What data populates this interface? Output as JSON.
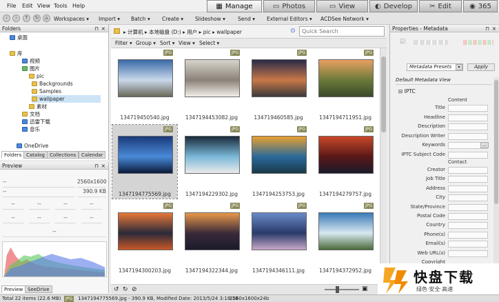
{
  "menu": {
    "file": "File",
    "edit": "Edit",
    "view": "View",
    "tools": "Tools",
    "help": "Help"
  },
  "modes": {
    "manage": "Manage",
    "photos": "Photos",
    "view": "View",
    "develop": "Develop",
    "edit": "Edit",
    "m365": "365"
  },
  "toolbar": {
    "workspaces": "Workspaces ▾",
    "import": "Import ▾",
    "batch": "Batch ▾",
    "create": "Create ▾",
    "slideshow": "Slideshow ▾",
    "send": "Send ▾",
    "external_editors": "External Editors ▾",
    "acdsee_network": "ACDSee Network ▾"
  },
  "folders": {
    "title": "Folders",
    "items": [
      "桌面",
      "库",
      "视频",
      "图片",
      "pic",
      "Backgrounds",
      "Samples",
      "wallpaper",
      "素材",
      "文档",
      "迅雷下载",
      "音乐",
      "OneDrive"
    ]
  },
  "left_tabs": [
    "Folders",
    "Catalog",
    "Collections",
    "Calendar"
  ],
  "preview": {
    "title": "Preview",
    "dims": "2560x1600",
    "dash": "--",
    "zoom": "390.9 KB"
  },
  "preview_tabs": [
    "Preview",
    "SeeDrive"
  ],
  "address": {
    "path": "▸ 计算机 ▸ 本地磁盘 (D:) ▸ 用户 ▸ pic ▸ wallpaper",
    "search_placeholder": "Quick Search"
  },
  "filterbar": {
    "filter": "Filter ▾",
    "group": "Group ▾",
    "sort": "Sort ▾",
    "view": "View ▾",
    "select": "Select ▾"
  },
  "files": [
    {
      "name": "134719450540.jpg",
      "badge": "JPG",
      "colors": [
        "#3a6aa8",
        "#c9d8ea",
        "#6a6a5a"
      ]
    },
    {
      "name": "1347194453082.jpg",
      "badge": "JPG",
      "colors": [
        "#d8d4cc",
        "#8a8278",
        "#f2efe8"
      ]
    },
    {
      "name": "134719460585.jpg",
      "badge": "JPG",
      "colors": [
        "#2a2a48",
        "#c87848",
        "#3a3a3a"
      ]
    },
    {
      "name": "1347194711951.jpg",
      "badge": "JPG",
      "colors": [
        "#e8a060",
        "#6a7a3a",
        "#3a4a28"
      ]
    },
    {
      "name": "1347194775569.jpg",
      "badge": "JPG",
      "colors": [
        "#1a3a7a",
        "#4a8ad8",
        "#0a1a3a"
      ]
    },
    {
      "name": "1347194229302.jpg",
      "badge": "JPG",
      "colors": [
        "#1a2a3a",
        "#7ab8d8",
        "#eaeaea"
      ]
    },
    {
      "name": "1347194253753.jpg",
      "badge": "JPG",
      "colors": [
        "#e8a030",
        "#2a6a9a",
        "#1a3a4a"
      ]
    },
    {
      "name": "1347194279757.jpg",
      "badge": "JPG",
      "colors": [
        "#c84828",
        "#5a1818",
        "#1a1a2a"
      ]
    },
    {
      "name": "1347194300203.jpg",
      "badge": "JPG",
      "colors": [
        "#e87838",
        "#2a2a3a",
        "#c85828"
      ]
    },
    {
      "name": "1347194322344.jpg",
      "badge": "JPG",
      "colors": [
        "#e89848",
        "#3a2a3a",
        "#1a1a2a"
      ]
    },
    {
      "name": "1347194346111.jpg",
      "badge": "JPG",
      "colors": [
        "#6a8ac8",
        "#2a3a6a",
        "#c8a8c8"
      ]
    },
    {
      "name": "1347194372952.jpg",
      "badge": "JPG",
      "colors": [
        "#3a7ab8",
        "#d8e8f0",
        "#4a6a3a"
      ]
    }
  ],
  "status": {
    "total": "Total 22 items (22.6 MB)",
    "type": "JPG",
    "file": "1347194775569.jpg - 390.9 KB, Modified Date: 2013/5/24 3:18:18",
    "dims": "2560x1600x24b"
  },
  "props": {
    "title": "Properties - Metadata",
    "preset": "Metadata Presets",
    "apply": "Apply",
    "view": "Default Metadata View",
    "iptc": "IPTC",
    "content": "Content",
    "contact": "Contact",
    "fields": [
      "Title",
      "Headline",
      "Description",
      "Description Writer",
      "Keywords",
      "IPTC Subject Code"
    ],
    "contact_fields": [
      "Creator",
      "Job Title",
      "Address",
      "City",
      "State/Province",
      "Postal Code",
      "Country",
      "Phone(s)",
      "Email(s)",
      "Web URL(s)",
      "Copyright"
    ]
  },
  "watermark": {
    "brand": "快盘下载",
    "sub": "绿色·安全·高速"
  }
}
